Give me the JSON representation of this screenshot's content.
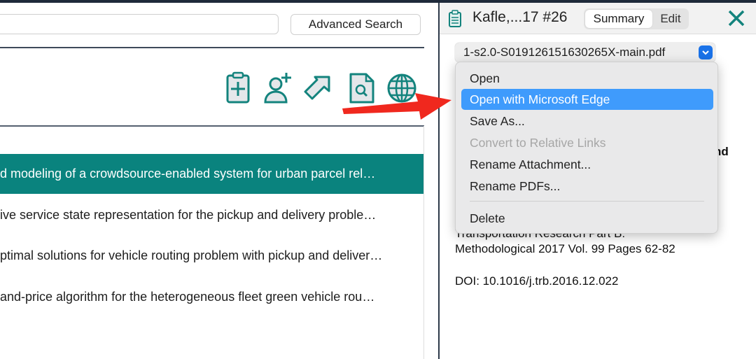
{
  "toolbar": {
    "advanced_search_label": "Advanced Search",
    "search_value": ""
  },
  "icons": [
    "new-note-icon",
    "add-author-icon",
    "go-arrow-icon",
    "find-pdf-icon",
    "web-globe-icon"
  ],
  "list": {
    "rows": [
      {
        "title": "d modeling of a crowdsource-enabled system for urban parcel rel…",
        "selected": true
      },
      {
        "title": "ive service state representation for the pickup and delivery proble…",
        "selected": false
      },
      {
        "title": "ptimal solutions for vehicle routing problem with pickup and deliver…",
        "selected": false
      },
      {
        "title": " and-price algorithm for the heterogeneous fleet green vehicle rou…",
        "selected": false
      }
    ]
  },
  "detail": {
    "title": "Kafle,...17 #26",
    "tabs": {
      "summary": "Summary",
      "edit": "Edit",
      "active": "Summary"
    },
    "attachment": "1-s2.0-S019126151630265X-main.pdf",
    "bold_fragment": "nd",
    "journal_line1": "Transportation Research Part B:",
    "journal_line2": "Methodological 2017 Vol. 99 Pages 62-82",
    "doi": "DOI: 10.1016/j.trb.2016.12.022"
  },
  "menu": {
    "items": [
      {
        "label": "Open",
        "state": "normal"
      },
      {
        "label": "Open with Microsoft Edge",
        "state": "highlighted"
      },
      {
        "label": "Save As...",
        "state": "normal"
      },
      {
        "label": "Convert to Relative Links",
        "state": "disabled"
      },
      {
        "label": "Rename Attachment...",
        "state": "normal"
      },
      {
        "label": "Rename PDFs...",
        "state": "normal"
      },
      {
        "label": "Delete",
        "state": "normal"
      }
    ]
  },
  "colors": {
    "accent": "#0a837e",
    "highlight": "#3f9bfc",
    "annotation_arrow": "#f0281e"
  }
}
